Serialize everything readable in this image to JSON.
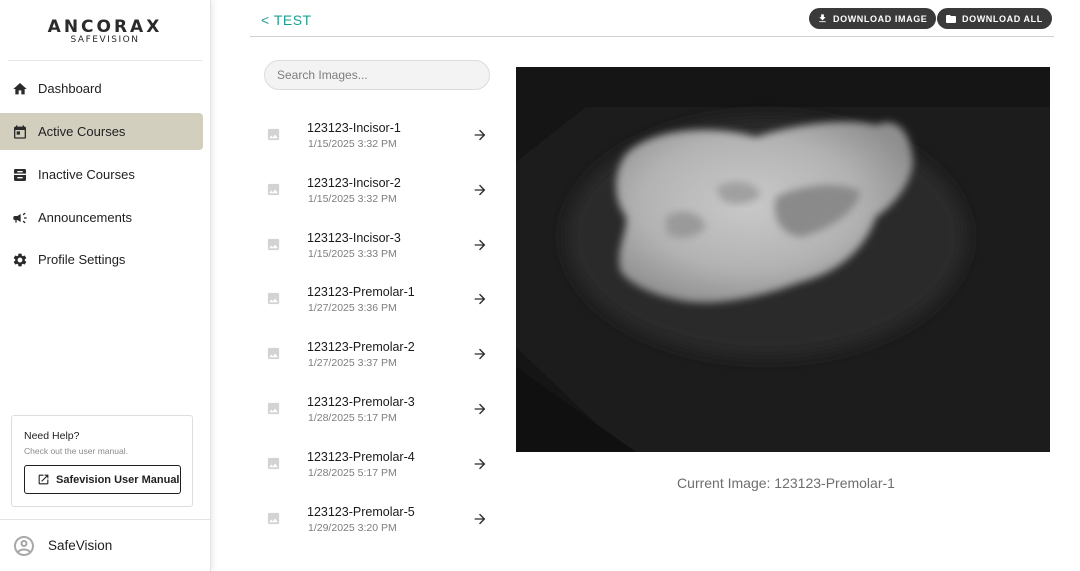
{
  "brand": {
    "logo_main": "ANCORAX",
    "logo_sub": "SAFEVISION"
  },
  "sidebar": {
    "items": [
      {
        "label": "Dashboard",
        "icon": "home-icon",
        "active": false
      },
      {
        "label": "Active Courses",
        "icon": "calendar-icon",
        "active": true
      },
      {
        "label": "Inactive Courses",
        "icon": "archive-icon",
        "active": false
      },
      {
        "label": "Announcements",
        "icon": "megaphone-icon",
        "active": false
      },
      {
        "label": "Profile Settings",
        "icon": "gear-icon",
        "active": false
      }
    ],
    "help": {
      "title": "Need Help?",
      "subtitle": "Check out the user manual.",
      "button_label": "Safevision User Manual"
    },
    "user": {
      "name": "SafeVision",
      "icon": "account-circle-icon"
    }
  },
  "header": {
    "back_label": "< TEST",
    "download_image_label": "DOWNLOAD IMAGE",
    "download_all_label": "DOWNLOAD ALL"
  },
  "search": {
    "placeholder": "Search Images...",
    "value": ""
  },
  "images": [
    {
      "name": "123123-Incisor-1",
      "date": "1/15/2025 3:32 PM"
    },
    {
      "name": "123123-Incisor-2",
      "date": "1/15/2025 3:32 PM"
    },
    {
      "name": "123123-Incisor-3",
      "date": "1/15/2025 3:33 PM"
    },
    {
      "name": "123123-Premolar-1",
      "date": "1/27/2025 3:36 PM"
    },
    {
      "name": "123123-Premolar-2",
      "date": "1/27/2025 3:37 PM"
    },
    {
      "name": "123123-Premolar-3",
      "date": "1/28/2025 5:17 PM"
    },
    {
      "name": "123123-Premolar-4",
      "date": "1/28/2025 5:17 PM"
    },
    {
      "name": "123123-Premolar-5",
      "date": "1/29/2025 3:20 PM"
    }
  ],
  "viewer": {
    "caption": "Current Image: 123123-Premolar-1"
  },
  "colors": {
    "accent": "#1e9e90",
    "active_nav": "#d2cfbf",
    "pill_bg": "#3a3a3a"
  }
}
